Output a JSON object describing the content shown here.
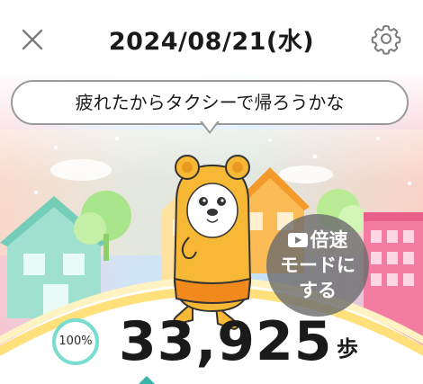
{
  "header": {
    "date_title": "2024/08/21(水)",
    "close_icon": "close-icon",
    "settings_icon": "gear-icon"
  },
  "speech_bubble": {
    "text": "疲れたからタクシーで帰ろうかな"
  },
  "speed_button": {
    "icon": "play-icon",
    "line1": "倍速",
    "line2": "モードに",
    "line3": "する"
  },
  "progress": {
    "percent_label": "100%",
    "percent_value": 100
  },
  "steps": {
    "count": "33,925",
    "unit": "歩"
  },
  "colors": {
    "ring": "#79dcd0",
    "accent_pointer": "#3ab4a8",
    "bear": "#f7b836",
    "shorts": "#f08a1c"
  }
}
